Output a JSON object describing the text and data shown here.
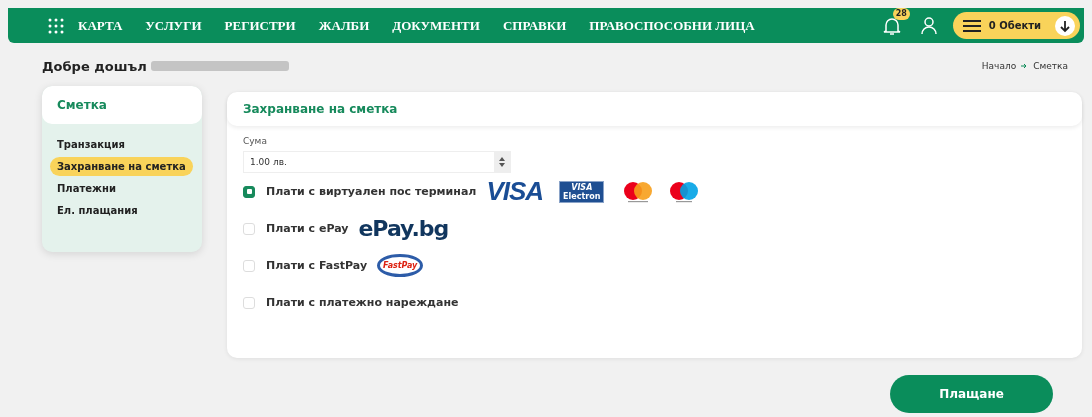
{
  "nav": {
    "items": [
      {
        "label": "КАРТА"
      },
      {
        "label": "УСЛУГИ"
      },
      {
        "label": "РЕГИСТРИ"
      },
      {
        "label": "ЖАЛБИ"
      },
      {
        "label": "ДОКУМЕНТИ"
      },
      {
        "label": "СПРАВКИ"
      },
      {
        "label": "ПРАВОСПОСОБНИ ЛИЦА"
      }
    ],
    "notifications": "28",
    "objects_button": "0 Обекти"
  },
  "welcome": "Добре дошъл",
  "breadcrumb": [
    "Начало",
    "Сметка"
  ],
  "sidebar": {
    "title": "Сметка",
    "items": [
      {
        "label": "Транзакция",
        "selected": false
      },
      {
        "label": "Захранване на сметка",
        "selected": true
      },
      {
        "label": "Платежни",
        "selected": false
      },
      {
        "label": "Ел. плащания",
        "selected": false
      }
    ]
  },
  "panel": {
    "title": "Захранване на сметка",
    "amount_label": "Сума",
    "amount_value": "1.00 лв.",
    "options": [
      {
        "label": "Плати с виртуален пос терминал",
        "checked": true,
        "logos": [
          {
            "kind": "visa",
            "text": "VISA"
          },
          {
            "kind": "visa-electron",
            "text": "VISA",
            "subtext": "Electron"
          },
          {
            "kind": "mastercard"
          },
          {
            "kind": "maestro"
          }
        ]
      },
      {
        "label": "Плати с ePay",
        "checked": false,
        "logos": [
          {
            "kind": "epay",
            "text": "ePay.bg"
          }
        ]
      },
      {
        "label": "Плати с FastPay",
        "checked": false,
        "logos": [
          {
            "kind": "fastpay",
            "text": "FastPay"
          }
        ]
      },
      {
        "label": "Плати с платежно нареждане",
        "checked": false
      }
    ]
  },
  "pay_button": "Плащане"
}
